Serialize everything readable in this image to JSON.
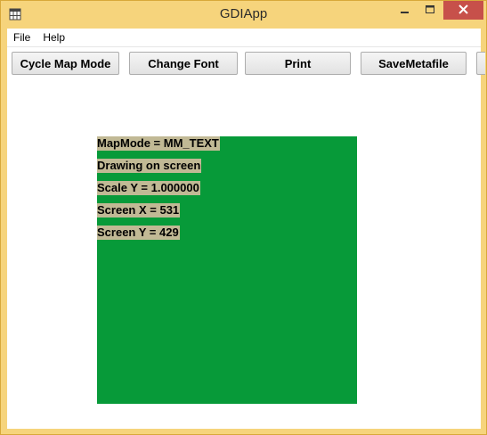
{
  "window": {
    "title": "GDIApp"
  },
  "menu": {
    "items": [
      "File",
      "Help"
    ]
  },
  "toolbar": {
    "buttons": [
      "Cycle Map Mode",
      "Change Font",
      "Print",
      "SaveMetafile",
      ""
    ]
  },
  "drawing": {
    "background_color": "#079a39",
    "text_background_color": "#c1b995",
    "lines": [
      "MapMode = MM_TEXT",
      "Drawing on screen",
      "Scale Y = 1.000000",
      "Screen X = 531",
      "Screen Y = 429"
    ]
  },
  "colors": {
    "frame": "#f6d47c",
    "close_button": "#c7504a"
  },
  "icons": {
    "app": "app-grid-icon",
    "minimize": "minimize-icon",
    "maximize": "maximize-icon",
    "close": "close-icon"
  }
}
